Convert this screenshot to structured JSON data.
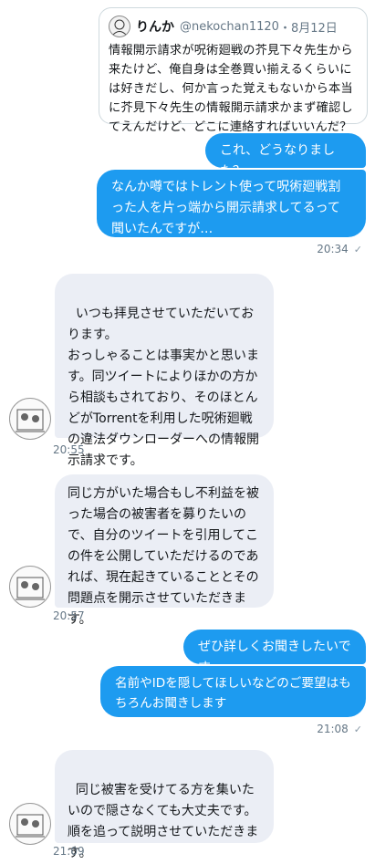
{
  "quoted_tweet": {
    "name": "りんか",
    "handle": "@nekochan1120",
    "date": "・8月12日",
    "text": "情報開示請求が呪術廻戦の芥見下々先生から来たけど、俺自身は全巻買い揃えるくらいには好きだし、何か言った覚えもないから本当に芥見下々先生の情報開示請求かまず確認してえんだけど、どこに連絡すればいいんだ？"
  },
  "messages": [
    {
      "id": "m1",
      "side": "out",
      "text": "これ、どうなりました？"
    },
    {
      "id": "m2",
      "side": "out",
      "text": "なんか噂ではトレント使って呪術廻戦割った人を片っ端から開示請求してるって聞いたんですが…",
      "time": "20:34",
      "status": "✓"
    },
    {
      "id": "m3",
      "side": "in",
      "text": "いつも拝見させていただいております。\nおっしゃることは事実かと思います。同ツイートによりほかの方から相談もされており、そのほとんどがTorrentを利用した呪術廻戦の違法ダウンローダーへの情報開示請求です。",
      "time": "20:55"
    },
    {
      "id": "m4",
      "side": "in",
      "text": "同じ方がいた場合もし不利益を被った場合の被害者を募りたいので、自分のツイートを引用してこの件を公開していただけるのであれば、現在起きていることとその問題点を開示させていただきます。",
      "time": "20:57"
    },
    {
      "id": "m5",
      "side": "out",
      "text": "ぜひ詳しくお聞きしたいです"
    },
    {
      "id": "m6",
      "side": "out",
      "text": "名前やIDを隠してほしいなどのご要望はもちろんお聞きします",
      "time": "21:08",
      "status": "✓"
    },
    {
      "id": "m7",
      "side": "in",
      "text": "同じ被害を受けてる方を集いたいので隠さなくても大丈夫です。\n順を追って説明させていただきます。",
      "time": "21:09"
    }
  ],
  "colors": {
    "outgoing": "#1d9bf0",
    "incoming": "#ebeef5",
    "meta": "#657786"
  }
}
